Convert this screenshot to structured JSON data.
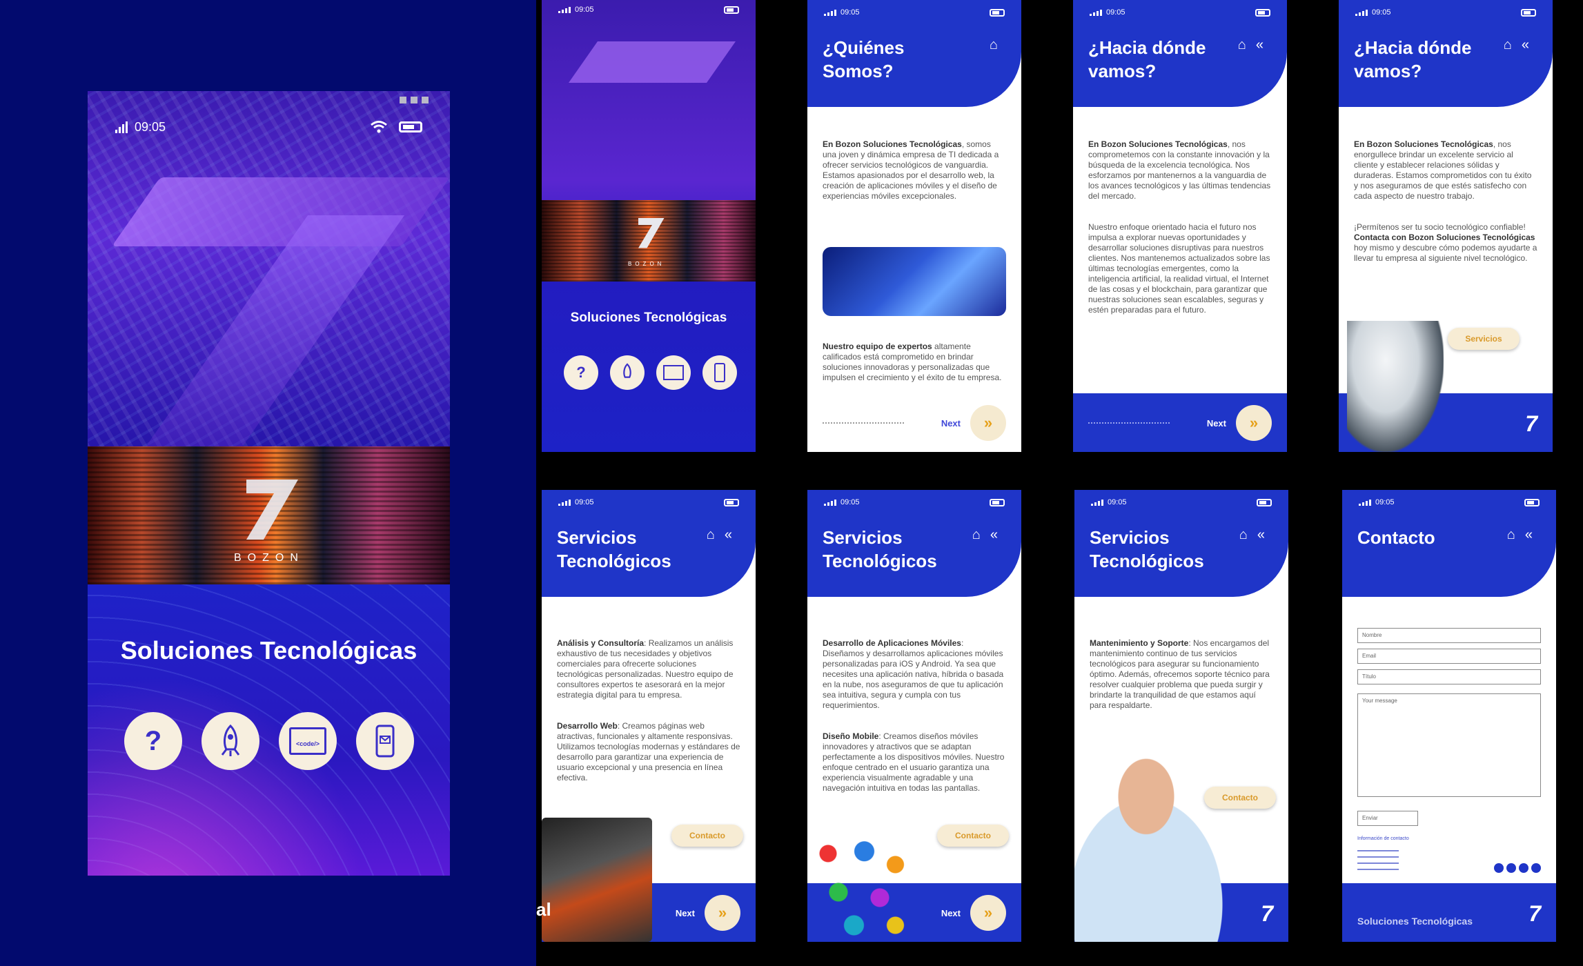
{
  "hero": {
    "time": "09:05",
    "brand": "BOZON",
    "title": "Soluciones Tecnológicas",
    "icon_code_label": "<code/>"
  },
  "splash": {
    "time": "09:05",
    "brand": "BOZON",
    "title": "Soluciones Tecnológicas"
  },
  "quienes": {
    "time": "09:05",
    "title": "¿Quiénes Somos?",
    "p1_bold": "En Bozon Soluciones Tecnológicas",
    "p1": ", somos una joven y dinámica empresa de TI dedicada a ofrecer servicios tecnológicos de vanguardia. Estamos apasionados por el desarrollo web, la creación de aplicaciones móviles y el diseño de experiencias móviles excepcionales.",
    "p2_bold": "Nuestro equipo de expertos",
    "p2": " altamente calificados está comprometido en brindar soluciones innovadoras y personalizadas que impulsen el crecimiento y el éxito de tu empresa.",
    "next": "Next"
  },
  "hacia1": {
    "time": "09:05",
    "title": "¿Hacia dónde vamos?",
    "p1_bold": "En Bozon Soluciones Tecnológicas",
    "p1": ", nos comprometemos con la constante innovación y la búsqueda de la excelencia tecnológica. Nos esforzamos por mantenernos a la vanguardia de los avances tecnológicos y las últimas tendencias del mercado.",
    "p2": "Nuestro enfoque orientado hacia el futuro nos impulsa a explorar nuevas oportunidades y desarrollar soluciones disruptivas para nuestros clientes. Nos mantenemos actualizados sobre las últimas tecnologías emergentes, como la inteligencia artificial, la realidad virtual, el Internet de las cosas y el blockchain, para garantizar que nuestras soluciones sean escalables, seguras y estén preparadas para el futuro.",
    "next": "Next"
  },
  "hacia2": {
    "time": "09:05",
    "title": "¿Hacia dónde vamos?",
    "p1_bold": "En Bozon Soluciones Tecnológicas",
    "p1": ", nos enorgullece brindar un excelente servicio al cliente y establecer relaciones sólidas y duraderas. Estamos comprometidos con tu éxito y nos aseguramos de que estés satisfecho con cada aspecto de nuestro trabajo.",
    "p2a": "¡Permítenos ser tu socio tecnológico confiable! ",
    "p2_bold": "Contacta con Bozon Soluciones Tecnológicas",
    "p2b": " hoy mismo y descubre cómo podemos ayudarte a llevar tu empresa al siguiente nivel tecnológico.",
    "button": "Servicios"
  },
  "serv1": {
    "time": "09:05",
    "title": "Servicios Tecnológicos",
    "h1": "Análisis y Consultoría",
    "t1": ": Realizamos un análisis exhaustivo de tus necesidades y objetivos comerciales para ofrecerte soluciones tecnológicas personalizadas. Nuestro equipo de consultores expertos te asesorará en la mejor estrategia digital para tu empresa.",
    "h2": "Desarrollo Web",
    "t2": ": Creamos páginas web atractivas, funcionales y altamente responsivas. Utilizamos tecnologías modernas y estándares de desarrollo para garantizar una experiencia de usuario excepcional y una presencia en línea efectiva.",
    "button": "Contacto",
    "next": "Next"
  },
  "serv2": {
    "time": "09:05",
    "title": "Servicios Tecnológicos",
    "h1": "Desarrollo de Aplicaciones Móviles",
    "t1": ": Diseñamos y desarrollamos aplicaciones móviles personalizadas para iOS y Android. Ya sea que necesites una aplicación nativa, híbrida o basada en la nube, nos aseguramos de que tu aplicación sea intuitiva, segura y cumpla con tus requerimientos.",
    "h2": "Diseño Mobile",
    "t2": ": Creamos diseños móviles innovadores y atractivos que se adaptan perfectamente a los dispositivos móviles. Nuestro enfoque centrado en el usuario garantiza una experiencia visualmente agradable y una navegación intuitiva en todas las pantallas.",
    "button": "Contacto",
    "next": "Next"
  },
  "serv3": {
    "time": "09:05",
    "title": "Servicios Tecnológicos",
    "h1": "Mantenimiento y Soporte",
    "t1": ": Nos encargamos del mantenimiento continuo de tus servicios tecnológicos para asegurar su funcionamiento óptimo. Además, ofrecemos soporte técnico para resolver cualquier problema que pueda surgir y brindarte la tranquilidad de que estamos aquí para respaldarte.",
    "button": "Contacto"
  },
  "contacto": {
    "time": "09:05",
    "title": "Contacto",
    "name_ph": "Nombre",
    "email_ph": "Email",
    "subject_ph": "Título",
    "message_ph": "Your message",
    "submit": "Enviar",
    "info_title": "Información de contacto",
    "footer": "Soluciones Tecnológicas"
  },
  "leftover": "al",
  "colors": {
    "brand_blue": "#1f35c8",
    "accent_gold": "#e6a11a",
    "cream": "#f7ecd4",
    "left_bg": "#020a6e"
  }
}
